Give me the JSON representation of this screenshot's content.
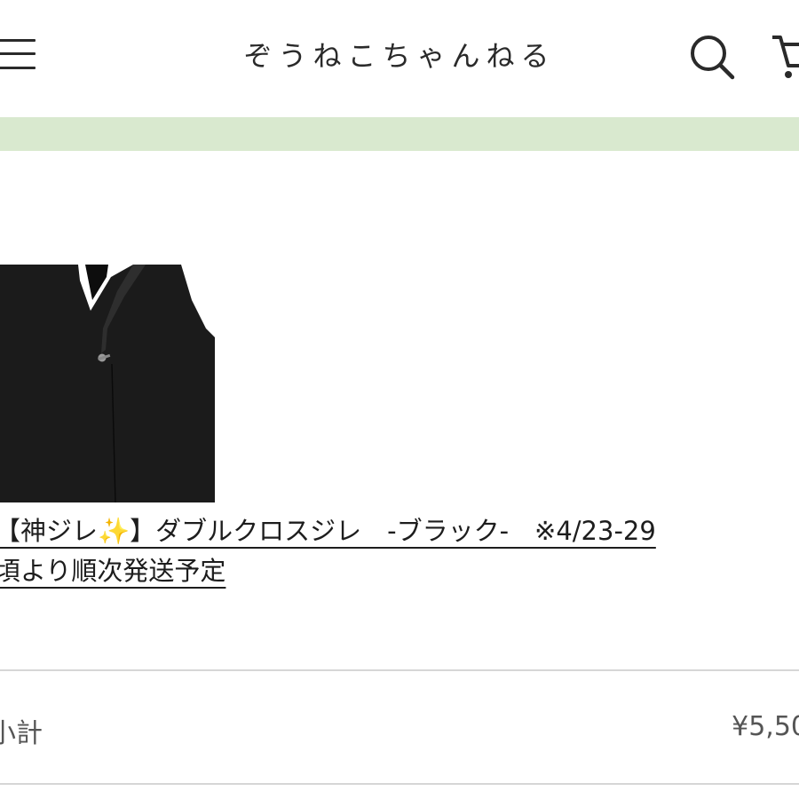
{
  "header": {
    "title": "ぞうねこちゃんねる",
    "menu_icon": "hamburger-menu-icon",
    "search_icon": "search-icon",
    "cart_icon": "cart-icon"
  },
  "banner": {
    "color": "#d9e9cf"
  },
  "product": {
    "image_alt": "black vest",
    "name_line1": "【神ジレ✨】ダブルクロスジレ　-ブラック-　※4/23-29",
    "name_line2": "頃より順次発送予定"
  },
  "summary": {
    "subtotal_label": "小計",
    "subtotal_value": "¥5,50"
  }
}
